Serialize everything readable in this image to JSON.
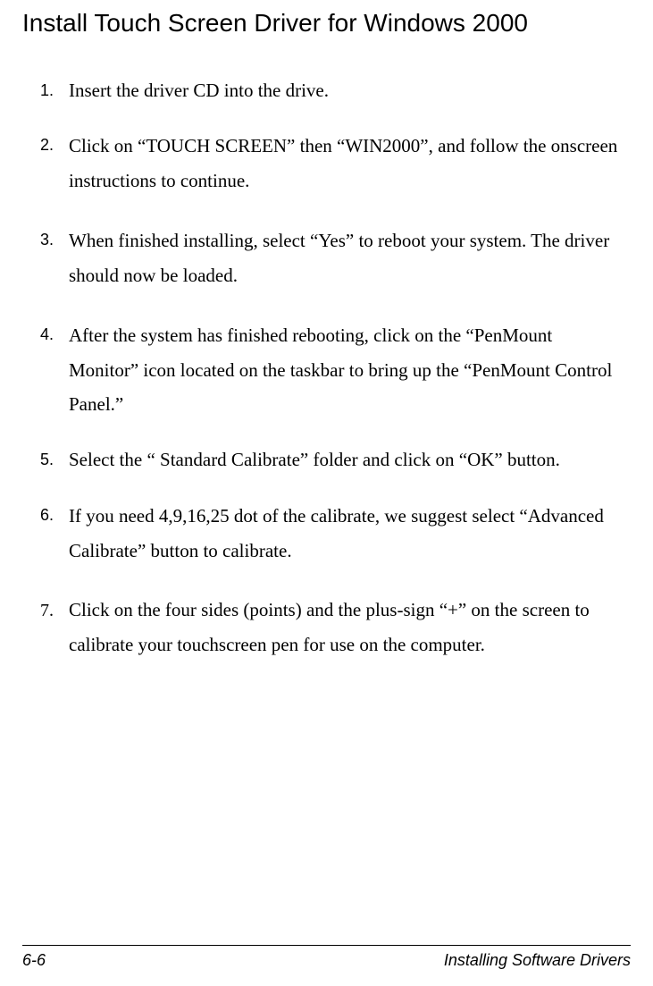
{
  "title": "Install Touch Screen Driver for Windows 2000",
  "items": [
    {
      "num": "1.",
      "text": "Insert the driver CD into the drive."
    },
    {
      "num": "2.",
      "text": "Click on “TOUCH SCREEN” then “WIN2000”, and follow the onscreen instructions to continue."
    },
    {
      "num": "3.",
      "text": "When finished installing, select “Yes” to reboot your system. The driver should now be loaded."
    },
    {
      "num": "4.",
      "text": "After the system has finished rebooting, click on the “PenMount Monitor” icon located on the taskbar to bring up the “PenMount Control Panel.”"
    },
    {
      "num": "5.",
      "text": "Select the “ Standard Calibrate” folder and click on “OK” button."
    },
    {
      "num": "6.",
      "text": "If you need 4,9,16,25 dot of the calibrate, we suggest select “Advanced Calibrate” button to calibrate."
    },
    {
      "num": "7.",
      "text": "Click on the four sides (points) and the plus-sign “+” on the screen to calibrate your touchscreen pen for use on the computer."
    }
  ],
  "footer": {
    "page": "6-6",
    "label": "Installing Software Drivers"
  }
}
